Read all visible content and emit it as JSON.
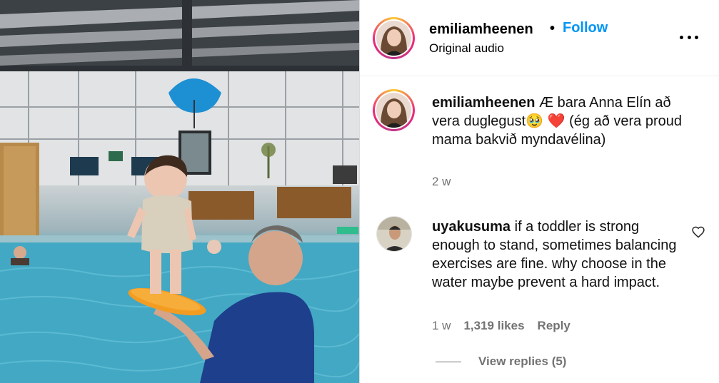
{
  "post": {
    "username": "emiliamheenen",
    "separator": "•",
    "follow_label": "Follow",
    "audio_label": "Original audio",
    "more_icon": "more-horizontal-icon"
  },
  "caption": {
    "username": "emiliamheenen",
    "text_part1": "Æ bara Anna Elín að vera duglegust",
    "emoji_1": "🥹",
    "emoji_2": "❤️",
    "text_part2": " (ég að vera proud mama bakvið myndavélina)",
    "time": "2 w"
  },
  "comment": {
    "username": "uyakusuma",
    "text": "if a toddler is strong enough to stand, sometimes balancing exercises are fine. why choose in the water maybe prevent a hard impact.",
    "time": "1 w",
    "likes": "1,319 likes",
    "reply_label": "Reply",
    "like_icon": "heart-icon"
  },
  "replies": {
    "label": "View replies (5)"
  }
}
